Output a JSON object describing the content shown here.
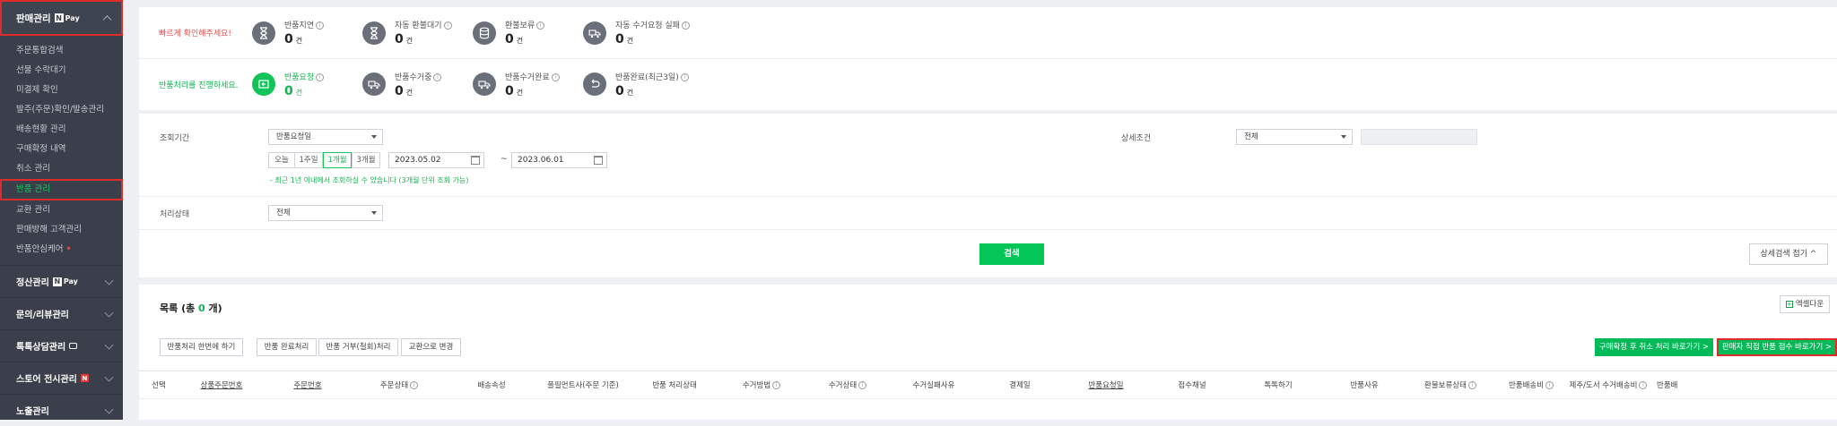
{
  "sidebar": {
    "header": {
      "label": "판매관리",
      "pay": "Pay"
    },
    "items": [
      {
        "label": "주문통합검색"
      },
      {
        "label": "선물 수락대기"
      },
      {
        "label": "미결제 확인"
      },
      {
        "label": "발주(주문)확인/발송관리"
      },
      {
        "label": "배송현황 관리"
      },
      {
        "label": "구매확정 내역"
      },
      {
        "label": "취소 관리"
      },
      {
        "label": "반품 관리"
      },
      {
        "label": "교환 관리"
      },
      {
        "label": "판매방해 고객관리"
      },
      {
        "label": "반품안심케어"
      }
    ],
    "groups": [
      {
        "label": "정산관리",
        "pay": "Pay"
      },
      {
        "label": "문의/리뷰관리"
      },
      {
        "label": "톡톡상담관리"
      },
      {
        "label": "스토어 전시관리",
        "badge": "N"
      },
      {
        "label": "노출관리"
      }
    ]
  },
  "status": {
    "row1": {
      "label": "빠르게 확인해주세요!",
      "stats": [
        {
          "title": "반품지연",
          "value": "0",
          "unit": "건"
        },
        {
          "title": "자동 환불대기",
          "value": "0",
          "unit": "건"
        },
        {
          "title": "환불보류",
          "value": "0",
          "unit": "건"
        },
        {
          "title": "자동 수거요청 실패",
          "value": "0",
          "unit": "건"
        }
      ]
    },
    "row2": {
      "label": "반품처리를 진행하세요.",
      "stats": [
        {
          "title": "반품요청",
          "value": "0",
          "unit": "건"
        },
        {
          "title": "반품수거중",
          "value": "0",
          "unit": "건"
        },
        {
          "title": "반품수거완료",
          "value": "0",
          "unit": "건"
        },
        {
          "title": "반품완료(최근3일)",
          "value": "0",
          "unit": "건"
        }
      ]
    }
  },
  "search": {
    "period_label": "조회기간",
    "period_select": "반품요청일",
    "periods": [
      "오늘",
      "1주일",
      "1개월",
      "3개월"
    ],
    "date_from": "2023.05.02",
    "date_sep": "~",
    "date_to": "2023.06.01",
    "period_note": "- 최근 1년 이내에서 조회하실 수 있습니다 (3개월 단위 조회 가능)",
    "detail_label": "상세조건",
    "detail_select": "전체",
    "status_label": "처리상태",
    "status_select": "전체",
    "search_button": "검색",
    "fold_button": "상세검색 접기 ^"
  },
  "list": {
    "title_prefix": "목록 (총 ",
    "count": "0",
    "title_suffix": " 개)",
    "excel_button": "엑셀다운",
    "actions": [
      "반품처리 한번에 하기",
      "반품 완료처리",
      "반품 거부(철회)처리",
      "교환으로 변경"
    ],
    "green_actions": [
      "구매확정 후 취소 처리 바로가기 >",
      "판매자 직접 반품 접수 바로가기 >"
    ],
    "columns": [
      "선택",
      "상품주문번호",
      "주문번호",
      "주문상태",
      "배송속성",
      "풀필먼트사(주문 기준)",
      "반품 처리상태",
      "수거방법",
      "수거상태",
      "수거실패사유",
      "결제일",
      "반품요청일",
      "접수채널",
      "톡톡하기",
      "반품사유",
      "환불보류상태",
      "반품배송비",
      "제주/도서 수거배송비",
      "반품배"
    ]
  }
}
